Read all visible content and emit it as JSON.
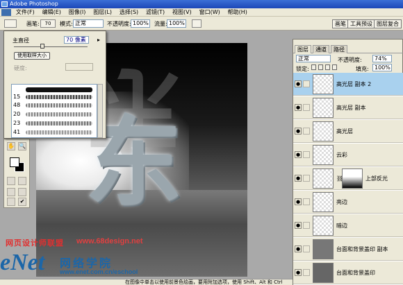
{
  "window": {
    "title": "Adobe Photoshop"
  },
  "menu": [
    "文件(F)",
    "编辑(E)",
    "图像(I)",
    "图层(L)",
    "选择(S)",
    "滤镜(T)",
    "视图(V)",
    "窗口(W)",
    "帮助(H)"
  ],
  "options": {
    "brush_label": "画笔:",
    "brush_size": "70",
    "mode_label": "模式:",
    "mode_value": "正常",
    "opacity_label": "不透明度:",
    "opacity_value": "100%",
    "flow_label": "流量:",
    "flow_value": "100%",
    "panel_tabs": [
      "画笔",
      "工具预设",
      "图层复合"
    ]
  },
  "brush_popup": {
    "diameter_label": "主直径",
    "diameter_value": "70 像素",
    "sample_button": "使用取样大小",
    "hardness_label": "硬度:",
    "presets": [
      {
        "size": ""
      },
      {
        "size": "15"
      },
      {
        "size": "48"
      },
      {
        "size": "20"
      },
      {
        "size": "23"
      },
      {
        "size": "41"
      }
    ]
  },
  "canvas": {
    "glyph": "东"
  },
  "layers_panel": {
    "tabs": [
      "图层",
      "通道",
      "路径"
    ],
    "blend_mode": "正常",
    "opacity_label": "不透明度:",
    "opacity_value": "74%",
    "lock_label": "锁定:",
    "fill_label": "填充:",
    "fill_value": "100%",
    "layers": [
      {
        "name": "高光层 副本 2",
        "selected": true
      },
      {
        "name": "高光层 副本",
        "selected": false
      },
      {
        "name": "高光层",
        "selected": false
      },
      {
        "name": "云彩",
        "selected": false
      },
      {
        "name": "上部反光",
        "selected": false,
        "has_mask": true
      },
      {
        "name": "亮边",
        "selected": false
      },
      {
        "name": "暗边",
        "selected": false
      },
      {
        "name": "台面和背景盖印 副本",
        "selected": false
      },
      {
        "name": "台面和背景盖印",
        "selected": false
      }
    ]
  },
  "watermark": {
    "cn_text": "网页设计师联盟",
    "url": "www.68design.net",
    "brand": "eNet",
    "brand_cn": "网络学院",
    "brand_url": "www.enet.com.cn/eschool"
  },
  "status": {
    "hint": "在图像中单击以使用前景色绘画，要用附加选项，使用 Shift、Alt 和 Ctrl 键。"
  }
}
